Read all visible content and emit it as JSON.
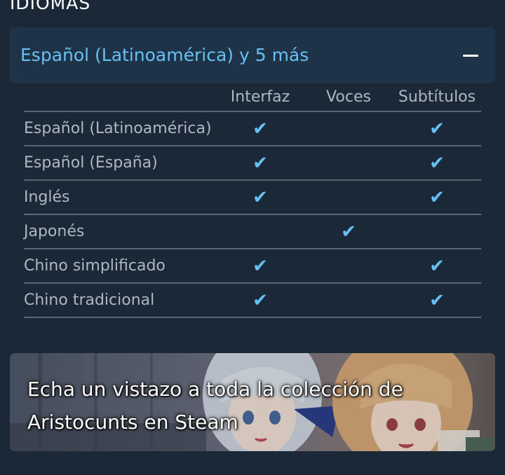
{
  "section": {
    "title": "IDIOMAS"
  },
  "languages": {
    "summary": "Español (Latinoamérica) y 5 más",
    "columns": [
      "Interfaz",
      "Voces",
      "Subtítulos"
    ],
    "check_glyph": "✔",
    "rows": [
      {
        "name": "Español (Latinoamérica)",
        "interfaz": true,
        "voces": false,
        "subtitulos": true
      },
      {
        "name": "Español (España)",
        "interfaz": true,
        "voces": false,
        "subtitulos": true
      },
      {
        "name": "Inglés",
        "interfaz": true,
        "voces": false,
        "subtitulos": true
      },
      {
        "name": "Japonés",
        "interfaz": false,
        "voces": true,
        "subtitulos": false
      },
      {
        "name": "Chino simplificado",
        "interfaz": true,
        "voces": false,
        "subtitulos": true
      },
      {
        "name": "Chino tradicional",
        "interfaz": true,
        "voces": false,
        "subtitulos": true
      }
    ]
  },
  "banner": {
    "text_line1": "Echa un vistazo a toda la colección de",
    "text_line2": "Aristocunts en Steam"
  },
  "colors": {
    "background": "#1b2838",
    "accent": "#66c0f4",
    "header_panel": "#1f3348"
  },
  "icons": {
    "collapse": "minus-icon",
    "check": "checkmark-icon"
  }
}
